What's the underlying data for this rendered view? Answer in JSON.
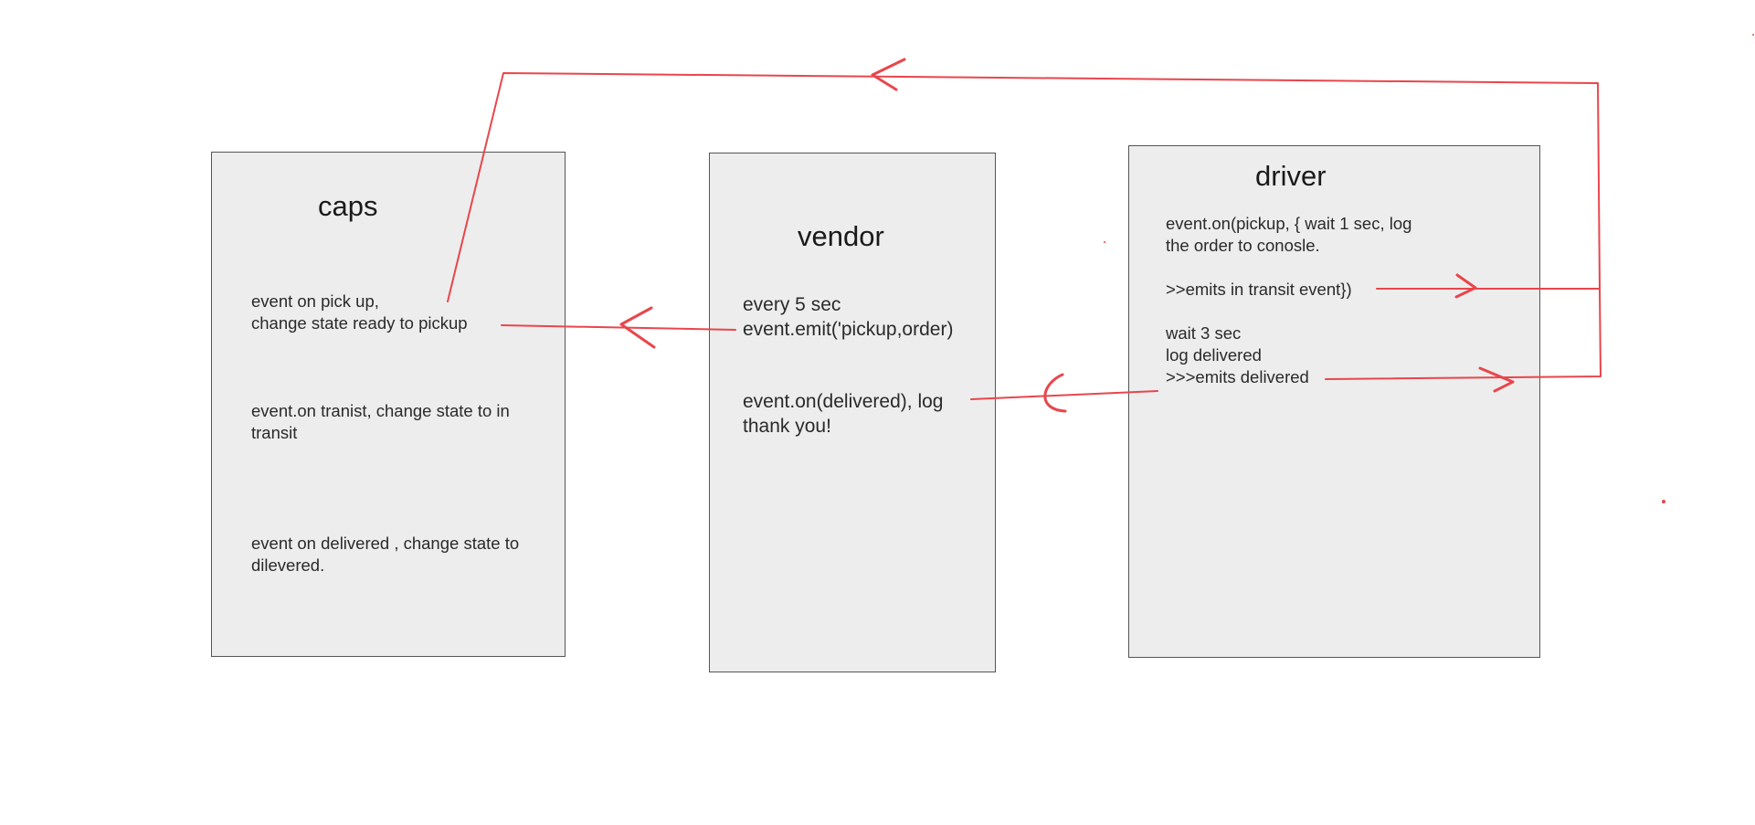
{
  "caps": {
    "title": "caps",
    "note_1": [
      "event on pick up,",
      "change state ready to pickup"
    ],
    "note_2": [
      "event.on tranist, change state to in",
      "transit"
    ],
    "note_3": [
      "event on delivered , change state to",
      "dilevered."
    ]
  },
  "vendor": {
    "title": "vendor",
    "note_1": [
      "every 5 sec",
      "event.emit('pickup,order)"
    ],
    "note_2": [
      "event.on(delivered), log",
      "thank you!"
    ]
  },
  "driver": {
    "title": "driver",
    "note_1": [
      "event.on(pickup, { wait 1 sec, log",
      "the order to conosle."
    ],
    "note_2": ">>emits in transit event})",
    "note_3": [
      "wait 3 sec",
      "log delivered",
      ">>>emits delivered"
    ]
  },
  "colors": {
    "box_fill": "#ededed",
    "box_border": "#555555",
    "arrow": "#e8464c"
  }
}
